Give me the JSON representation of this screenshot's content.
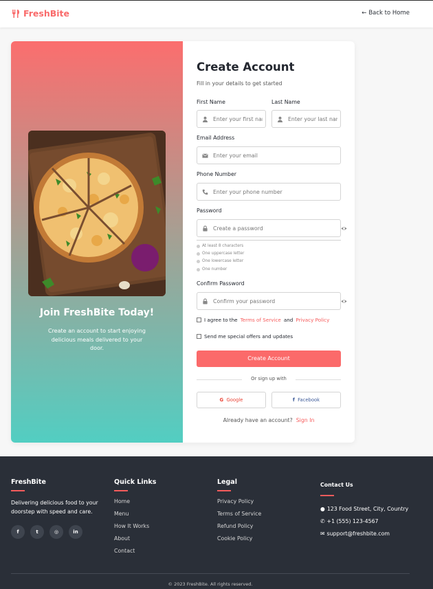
{
  "header": {
    "brand": "FreshBite",
    "back_label": "Back to Home"
  },
  "promo": {
    "title": "Join FreshBite Today!",
    "subtitle": "Create an account to start enjoying delicious meals delivered to your door."
  },
  "form": {
    "title": "Create Account",
    "subtitle": "Fill in your details to get started",
    "first_name": {
      "label": "First Name",
      "placeholder": "Enter your first name"
    },
    "last_name": {
      "label": "Last Name",
      "placeholder": "Enter your last name"
    },
    "email": {
      "label": "Email Address",
      "placeholder": "Enter your email"
    },
    "phone": {
      "label": "Phone Number",
      "placeholder": "Enter your phone number"
    },
    "password": {
      "label": "Password",
      "placeholder": "Create a password"
    },
    "requirements": [
      "At least 8 characters",
      "One uppercase letter",
      "One lowercase letter",
      "One number"
    ],
    "confirm": {
      "label": "Confirm Password",
      "placeholder": "Confirm your password"
    },
    "agree_prefix": "I agree to the",
    "terms": "Terms of Service",
    "and": "and",
    "privacy": "Privacy Policy",
    "offers": "Send me special offers and updates",
    "submit": "Create Account",
    "or_text": "Or sign up with",
    "google": "Google",
    "facebook": "Facebook",
    "have_account": "Already have an account?",
    "sign_in": "Sign In"
  },
  "footer": {
    "brand": "FreshBite",
    "description": "Delivering delicious food to your doorstep with speed and care.",
    "social_icons": [
      "facebook-icon",
      "twitter-icon",
      "instagram-icon",
      "linkedin-icon"
    ],
    "quick_links_title": "Quick Links",
    "quick_links": [
      "Home",
      "Menu",
      "How It Works",
      "About",
      "Contact"
    ],
    "legal_title": "Legal",
    "legal_links": [
      "Privacy Policy",
      "Terms of Service",
      "Refund Policy",
      "Cookie Policy"
    ],
    "contact_title": "Contact Us",
    "address": "123 Food Street, City, Country",
    "phone": "+1 (555) 123-4567",
    "email": "support@freshbite.com",
    "copyright": "© 2023 FreshBite. All rights reserved."
  },
  "colors": {
    "accent": "#fb6a6a",
    "gradient_top": "#fb6e6e",
    "gradient_bottom": "#52cec2",
    "footer_bg": "#2a2f38"
  }
}
